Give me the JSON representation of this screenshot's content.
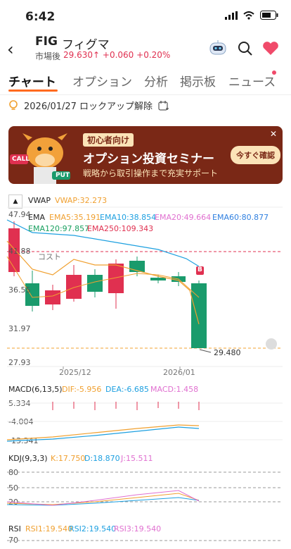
{
  "status": {
    "time": "6:42"
  },
  "header": {
    "ticker": "FIG",
    "name": "フィグマ",
    "market_label": "市場後",
    "price": "29.630",
    "change": "+0.060",
    "change_pct": "+0.20%"
  },
  "tabs": [
    {
      "label": "チャート"
    },
    {
      "label": "オプション"
    },
    {
      "label": "分析"
    },
    {
      "label": "掲示板"
    },
    {
      "label": "ニュース"
    }
  ],
  "info": {
    "text": "2026/01/27 ロックアップ解除"
  },
  "banner": {
    "tag": "初心者向け",
    "title": "オプション投資セミナー",
    "subtitle": "戦略から取引操作まで充実サポート",
    "cta": "今すぐ確認",
    "call": "CALL",
    "put": "PUT"
  },
  "chart": {
    "vwap_label": "VWAP",
    "vwap_value": "VWAP:32.273",
    "ema_label": "EMA",
    "ema5": "EMA5:35.191",
    "ema10": "EMA10:38.854",
    "ema20": "EMA20:49.664",
    "ema60": "EMA60:80.877",
    "ema120": "EMA120:97.857",
    "ema250": "EMA250:109.343",
    "y_ticks": [
      "47.94",
      "41.88",
      "36.55",
      "31.97",
      "27.93"
    ],
    "cost_label": "コスト",
    "last_price_label": "29.480",
    "marker_label": "B",
    "x_ticks": [
      "2025/12",
      "2026/01"
    ]
  },
  "macd": {
    "label": "MACD(6,13,5)",
    "dif": "DIF:-5.956",
    "dea": "DEA:-6.685",
    "macd": "MACD:1.458",
    "y_ticks": [
      "5.334",
      "-4.004",
      "-13.341"
    ]
  },
  "kdj": {
    "label": "KDJ(9,3,3)",
    "k": "K:17.750",
    "d": "D:18.870",
    "j": "J:15.511",
    "y_ticks": [
      "80",
      "50",
      "20"
    ]
  },
  "rsi": {
    "label": "RSI",
    "rsi1": "RSI1:19.540",
    "rsi2": "RSI2:19.540",
    "rsi3": "RSI3:19.540",
    "y_ticks": [
      "70"
    ]
  },
  "colors": {
    "up": "#e03050",
    "down": "#1a9b6c",
    "accent": "#ff6a1f",
    "ema5": "#f0a030",
    "ema10": "#1ea0e0",
    "ema20": "#e070d0",
    "ema60": "#3080e0",
    "ema120": "#1aa060",
    "ema250": "#e03050"
  }
}
